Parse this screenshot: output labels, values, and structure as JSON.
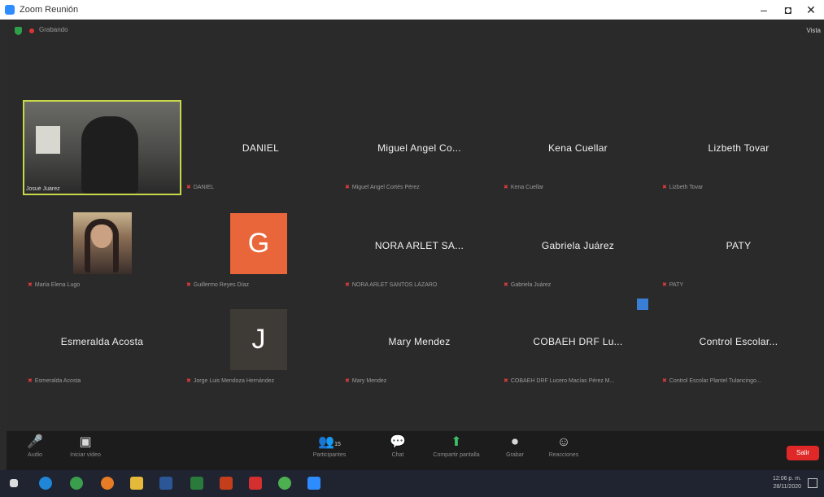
{
  "window": {
    "title": "Zoom Reunión",
    "minimize": "–",
    "maximize": "◘",
    "close": "✕"
  },
  "topbar": {
    "recording_label": "Grabando",
    "view_label": "Vista"
  },
  "tiles": [
    {
      "name": "",
      "label": "Josué Juárez"
    },
    {
      "name": "DANIEL",
      "label": "DANIEL"
    },
    {
      "name": "Miguel Angel Co...",
      "label": "Miguel Angel Cortés Pérez"
    },
    {
      "name": "Kena Cuellar",
      "label": "Kena Cuellar"
    },
    {
      "name": "Lizbeth Tovar",
      "label": "Lizbeth Tovar"
    },
    {
      "name": "",
      "label": "María Elena Lugo"
    },
    {
      "name": "",
      "label": "Guillermo Reyes Díaz",
      "initial": "G"
    },
    {
      "name": "NORA ARLET SA...",
      "label": "NORA ARLET SANTOS LÁZARO"
    },
    {
      "name": "Gabriela Juárez",
      "label": "Gabriela Juárez"
    },
    {
      "name": "PATY",
      "label": "PATY"
    },
    {
      "name": "Esmeralda Acosta",
      "label": "Esmeralda Acosta"
    },
    {
      "name": "",
      "label": "Jorge Luis Mendoza Hernández",
      "initial": "J"
    },
    {
      "name": "Mary Mendez",
      "label": "Mary Mendez"
    },
    {
      "name": "COBAEH DRF Lu...",
      "label": "COBAEH DRF Lucero Macías Pérez M..."
    },
    {
      "name": "Control Escolar...",
      "label": "Control Escolar Plantel Tulancingo..."
    }
  ],
  "toolbar": {
    "audio": "Audio",
    "video": "Iniciar vídeo",
    "participants": "Participantes",
    "participants_count": "15",
    "chat": "Chat",
    "share": "Compartir pantalla",
    "record": "Grabar",
    "reactions": "Reacciones",
    "end": "Salir"
  },
  "taskbar": {
    "time": "12:06 p. m.",
    "date": "28/11/2020"
  },
  "colors": {
    "active_border": "#c8d84a",
    "avatar_g": "#e8663a",
    "avatar_j": "#3e3a36",
    "end_button": "#e02828"
  }
}
